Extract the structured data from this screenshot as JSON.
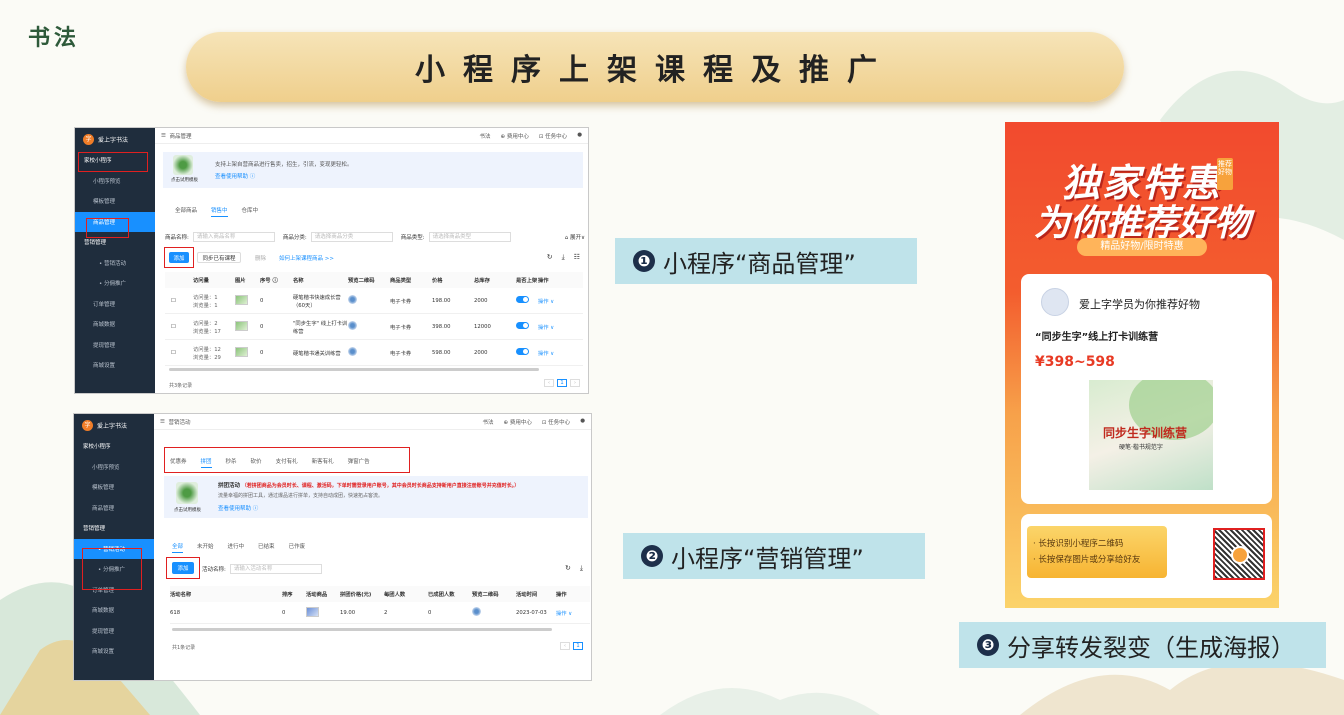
{
  "logo": "书法",
  "banner_title": "小程序上架课程及推广",
  "shot1": {
    "brand": "爱上字书法",
    "breadcrumb": "商品管理",
    "top_right": [
      "书法",
      "⊕ 费用中心",
      "⊡ 任务中心"
    ],
    "sidebar": [
      "家校小程序",
      "小程序预览",
      "模板管理",
      "商品管理",
      "营销管理",
      "• 营销活动",
      "• 分佣推广",
      "订单管理",
      "商城数据",
      "提现管理",
      "商城设置"
    ],
    "tip_text": "支持上架自营商品进行售卖，招生，引流，变现更轻松。",
    "tip_link": "查看使用帮助 ⓘ",
    "tip_img_caption": "点击试用模板",
    "tabs": [
      "全部商品",
      "销售中",
      "仓库中"
    ],
    "filter_name_label": "商品名称:",
    "filter_name_placeholder": "请输入商品名称",
    "filter_cat_label": "商品分类:",
    "filter_cat_placeholder": "请选择商品分类",
    "filter_type_label": "商品类型:",
    "filter_type_placeholder": "请选择商品类型",
    "expand": "展开",
    "add": "添加",
    "sync": "同步已有课程",
    "del": "删除",
    "how": "如何上架课程商品 >>",
    "columns": [
      "访问量",
      "图片",
      "序号 ⓘ",
      "名称",
      "预览二维码",
      "商品类型",
      "价格",
      "总库存",
      "是否上架",
      "操作"
    ],
    "rows": [
      {
        "visits": "访问量：1",
        "browse": "浏览量：1",
        "seq": "0",
        "name": "硬笔楷书快速成长营（60天）",
        "type": "电子卡券",
        "price": "198.00",
        "stock": "2000",
        "op": "操作 ∨"
      },
      {
        "visits": "访问量：2",
        "browse": "浏览量：17",
        "seq": "0",
        "name": "\"同步生字\" 线上打卡训练营",
        "type": "电子卡券",
        "price": "398.00",
        "stock": "12000",
        "op": "操作 ∨"
      },
      {
        "visits": "访问量：12",
        "browse": "浏览量：29",
        "seq": "0",
        "name": "硬笔楷书通关训练营",
        "type": "电子卡券",
        "price": "598.00",
        "stock": "2000",
        "op": "操作 ∨"
      }
    ],
    "total": "共3条记录",
    "page": "1"
  },
  "shot2": {
    "brand": "爱上字书法",
    "breadcrumb": "营销活动",
    "top_right": [
      "书法",
      "⊕ 费用中心",
      "⊡ 任务中心"
    ],
    "sidebar": [
      "家校小程序",
      "小程序预览",
      "模板管理",
      "商品管理",
      "营销管理",
      "• 营销活动",
      "• 分佣推广",
      "订单管理",
      "商城数据",
      "提现管理",
      "商城设置"
    ],
    "type_tabs": [
      "优惠券",
      "拼团",
      "秒杀",
      "砍价",
      "支付有礼",
      "新客有礼",
      "弹窗广告"
    ],
    "tip_title": "拼团活动",
    "tip_red": "（若拼团商品为会员时长、课程、激活码，下单时需登录用户账号，其中会员时长商品支持新用户直接注册账号并充值时长。）",
    "tip_text": "流量幸福的拼团工具，通过爆品进行拼单，支持自动成团，快速拓占客流。",
    "tip_link": "查看使用帮助 ⓘ",
    "tip_img_caption": "点击试用模板",
    "status_tabs": [
      "全部",
      "未开始",
      "进行中",
      "已结束",
      "已作废"
    ],
    "add": "添加",
    "name_label": "活动名称:",
    "name_placeholder": "请输入活动名称",
    "columns": [
      "活动名称",
      "排序",
      "活动商品",
      "拼团价格(元)",
      "每团人数",
      "已成团人数",
      "预览二维码",
      "活动时间",
      "操作"
    ],
    "rows": [
      {
        "name": "618",
        "seq": "0",
        "price": "19.00",
        "per": "2",
        "done": "0",
        "time": "2023-07-03",
        "op": "操作 ∨"
      }
    ],
    "total": "共1条记录",
    "page": "1"
  },
  "labels": {
    "l1_num": "❶",
    "l1": "小程序“商品管理”",
    "l2_num": "❷",
    "l2": "小程序“营销管理”",
    "l3_num": "❸",
    "l3": "分享转发裂变（生成海报）"
  },
  "poster": {
    "title1": "独家特惠",
    "badge": "推荐好物",
    "title2": "为你推荐好物",
    "sub": "精品好物/限时特惠",
    "user_line": "爱上字学员为你推荐好物",
    "course": "“同步生字”线上打卡训练营",
    "price": "¥398~598",
    "book_title": "同步生字训练营",
    "book_sub": "硬笔·楷书规范字",
    "qr_lines": [
      "· 长按识别小程序二维码",
      "· 长按保存图片或分享给好友"
    ]
  },
  "colors": {
    "accent": "#1890ff",
    "sidebar": "#1f2d3d",
    "highlight": "#e02020",
    "poster_red": "#f24a2e",
    "label_bg": "#bfe3ea"
  }
}
